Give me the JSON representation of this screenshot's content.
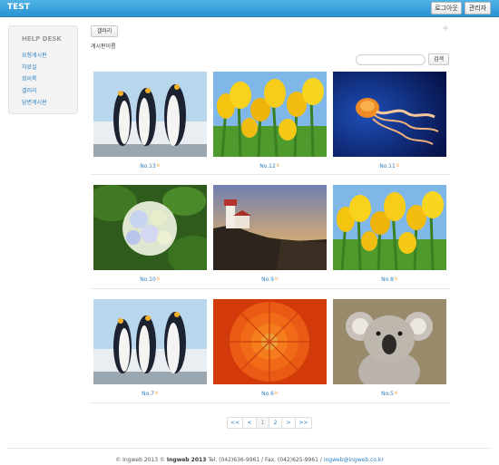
{
  "header": {
    "brand": "TEST",
    "logout_label": "로그아웃",
    "admin_label": "관리자"
  },
  "sidebar": {
    "title": "HELP DESK",
    "items": [
      {
        "label": "요청게시판"
      },
      {
        "label": "자료실"
      },
      {
        "label": "회의록"
      },
      {
        "label": "갤러리"
      },
      {
        "label": "답변게시판"
      }
    ]
  },
  "main": {
    "gallery_button": "갤러리",
    "plus_icon": "+",
    "board_name": "게시판이름",
    "search_placeholder": "",
    "search_button": "검색"
  },
  "gallery": {
    "items": [
      {
        "label": "No.13",
        "new": "N",
        "image": "penguins"
      },
      {
        "label": "No.12",
        "new": "N",
        "image": "tulips"
      },
      {
        "label": "No.11",
        "new": "N",
        "image": "jellyfish"
      },
      {
        "label": "No.10",
        "new": "N",
        "image": "hydrangea"
      },
      {
        "label": "No.9",
        "new": "N",
        "image": "lighthouse"
      },
      {
        "label": "No.8",
        "new": "N",
        "image": "tulips"
      },
      {
        "label": "No.7",
        "new": "N",
        "image": "penguins"
      },
      {
        "label": "No.6",
        "new": "N",
        "image": "chrysanthemum"
      },
      {
        "label": "No.5",
        "new": "N",
        "image": "koala"
      }
    ]
  },
  "pagination": {
    "first": "<<",
    "prev": "<",
    "pages": [
      "1",
      "2"
    ],
    "current": "1",
    "next": ">",
    "last": ">>"
  },
  "footer": {
    "copy1": "© Ingweb 2013 ©",
    "company": "Ingweb 2013",
    "contact": "Tel. (042)636-9961 / Fax. (042)625-9961 /",
    "email": "ingweb@ingweb.co.kr"
  },
  "colors": {
    "header_blue": "#2b92d0",
    "link_blue": "#2b7fc1",
    "new_badge": "#f0a030"
  }
}
